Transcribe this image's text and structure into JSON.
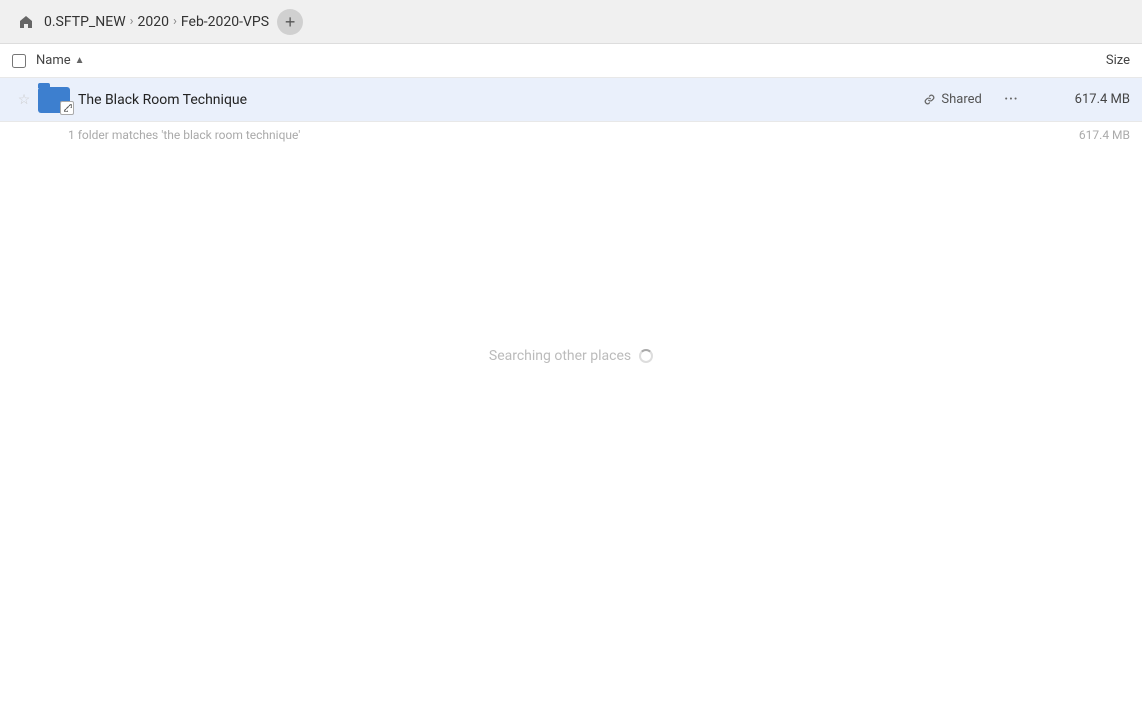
{
  "toolbar": {
    "home_icon": "🏠",
    "breadcrumbs": [
      {
        "label": "0.SFTP_NEW",
        "separator": "›"
      },
      {
        "label": "2020",
        "separator": "›"
      },
      {
        "label": "Feb-2020-VPS",
        "separator": ""
      }
    ],
    "add_button_label": "+"
  },
  "column_header": {
    "checkbox_checked": false,
    "name_label": "Name",
    "sort_arrow": "▲",
    "size_label": "Size"
  },
  "file_list": [
    {
      "starred": false,
      "icon_type": "folder-linked",
      "name": "The Black Room Technique",
      "shared": true,
      "shared_label": "Shared",
      "size": "617.4 MB"
    }
  ],
  "summary": {
    "text": "1 folder matches 'the black room technique'",
    "size": "617.4 MB"
  },
  "searching": {
    "text": "Searching other places"
  }
}
